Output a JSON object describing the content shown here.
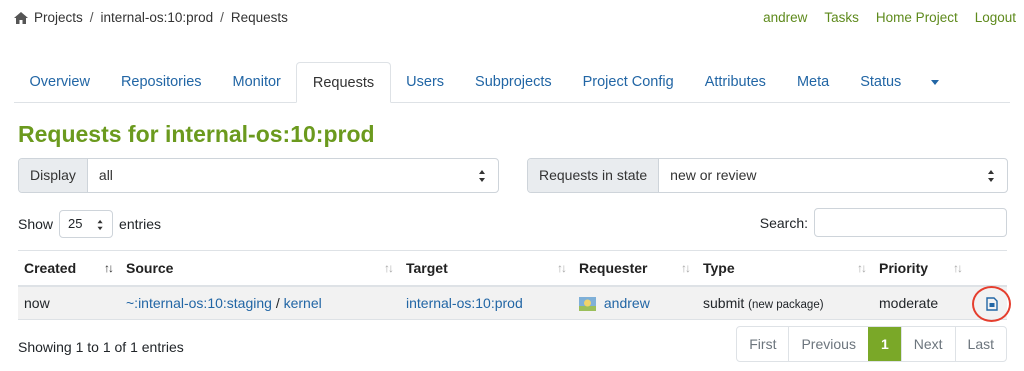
{
  "breadcrumb": {
    "items": [
      "Projects",
      "internal-os:10:prod",
      "Requests"
    ],
    "separator": "/"
  },
  "user_links": [
    "andrew",
    "Tasks",
    "Home Project",
    "Logout"
  ],
  "tabs": [
    {
      "label": "Overview"
    },
    {
      "label": "Repositories"
    },
    {
      "label": "Monitor"
    },
    {
      "label": "Requests",
      "active": true
    },
    {
      "label": "Users"
    },
    {
      "label": "Subprojects"
    },
    {
      "label": "Project Config"
    },
    {
      "label": "Attributes"
    },
    {
      "label": "Meta"
    },
    {
      "label": "Status"
    }
  ],
  "page_title": "Requests for internal-os:10:prod",
  "filters": {
    "display_label": "Display",
    "display_value": "all",
    "state_label": "Requests in state",
    "state_value": "new or review"
  },
  "entries": {
    "show_label": "Show",
    "page_length": "25",
    "entries_label": "entries",
    "search_label": "Search:"
  },
  "table": {
    "headers": [
      "Created",
      "Source",
      "Target",
      "Requester",
      "Type",
      "Priority"
    ],
    "rows": [
      {
        "created": "now",
        "source_project": "~:internal-os:10:staging",
        "source_sep": "/",
        "source_package": "kernel",
        "target": "internal-os:10:prod",
        "requester": "andrew",
        "type": "submit",
        "type_note": "(new package)",
        "priority": "moderate"
      }
    ]
  },
  "footer": {
    "info": "Showing 1 to 1 of 1 entries",
    "pager": [
      "First",
      "Previous",
      "1",
      "Next",
      "Last"
    ]
  },
  "colors": {
    "accent_green": "#6b9a1e",
    "link_blue": "#2266a5",
    "highlight_red": "#e53e2e"
  }
}
